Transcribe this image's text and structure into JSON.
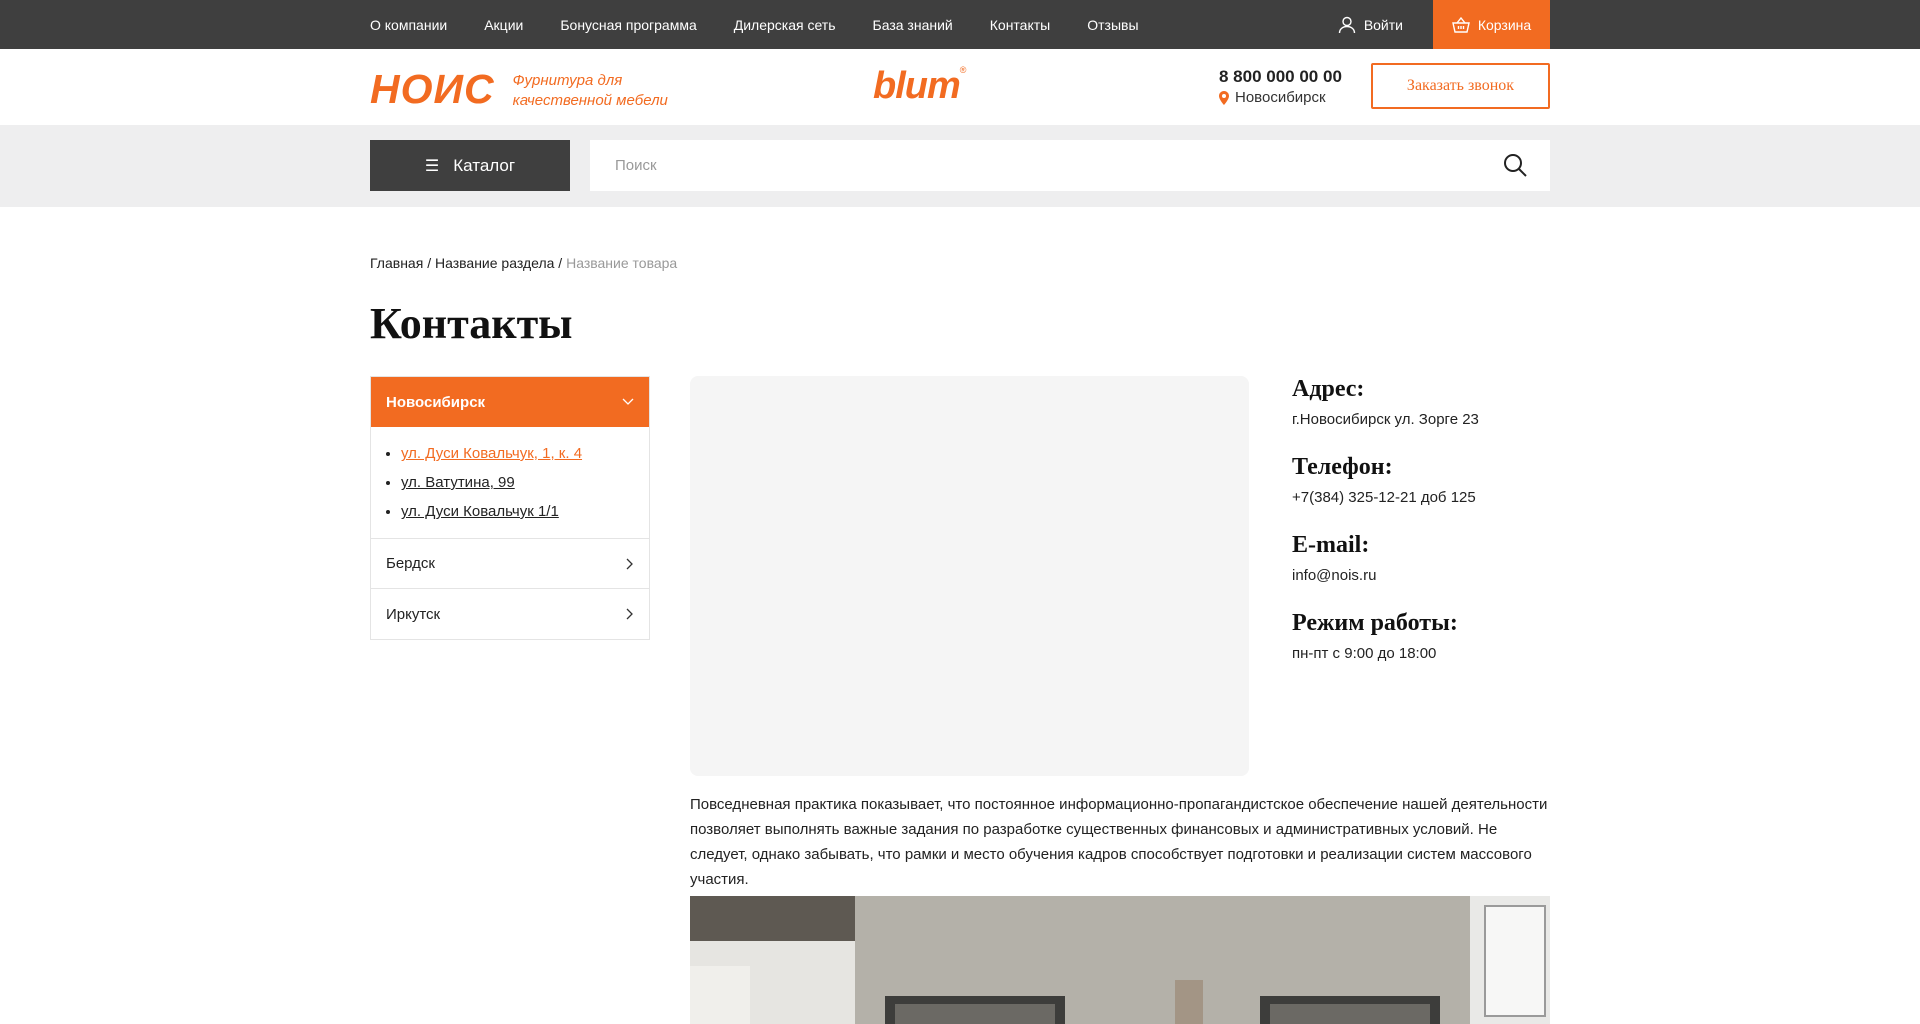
{
  "topnav": {
    "items": [
      "О компании",
      "Акции",
      "Бонусная программа",
      "Дилерская сеть",
      "База знаний",
      "Контакты",
      "Отзывы"
    ],
    "login": "Войти",
    "cart": "Корзина"
  },
  "header": {
    "logo": "НОИС",
    "tagline_1": "Фурнитура для",
    "tagline_2": "качественной мебели",
    "brand": "blum",
    "brand_mark": "®",
    "phone": "8 800 000 00 00",
    "city": "Новосибирск",
    "callback": "Заказать звонок"
  },
  "search": {
    "catalog": "Каталог",
    "placeholder": "Поиск"
  },
  "breadcrumb": {
    "home": "Главная",
    "section": "Название раздела",
    "current": "Название товара",
    "sep": "/"
  },
  "page": {
    "title": "Контакты"
  },
  "cities": {
    "active": "Новосибирск",
    "addresses": [
      "ул. Дуси Ковальчук, 1, к. 4",
      "ул. Ватутина, 99",
      "ул. Дуси Ковальчук 1/1"
    ],
    "others": [
      "Бердск",
      "Иркутск"
    ]
  },
  "contact": {
    "address_label": "Адрес:",
    "address": "г.Новосибирск ул. Зорге 23",
    "phone_label": "Телефон:",
    "phone": "+7(384) 325-12-21 доб 125",
    "email_label": "E-mail:",
    "email": "info@nois.ru",
    "hours_label": "Режим работы:",
    "hours": "пн-пт с 9:00 до 18:00"
  },
  "description": "Повседневная практика показывает, что постоянное информационно-пропагандистское обеспечение нашей деятельности позволяет выполнять важные задания по разработке существенных финансовых и административных условий. Не следует, однако забывать, что рамки и место обучения кадров способствует подготовки и реализации систем массового участия.",
  "colors": {
    "accent": "#f26b21",
    "dark": "#3f3f3f"
  }
}
